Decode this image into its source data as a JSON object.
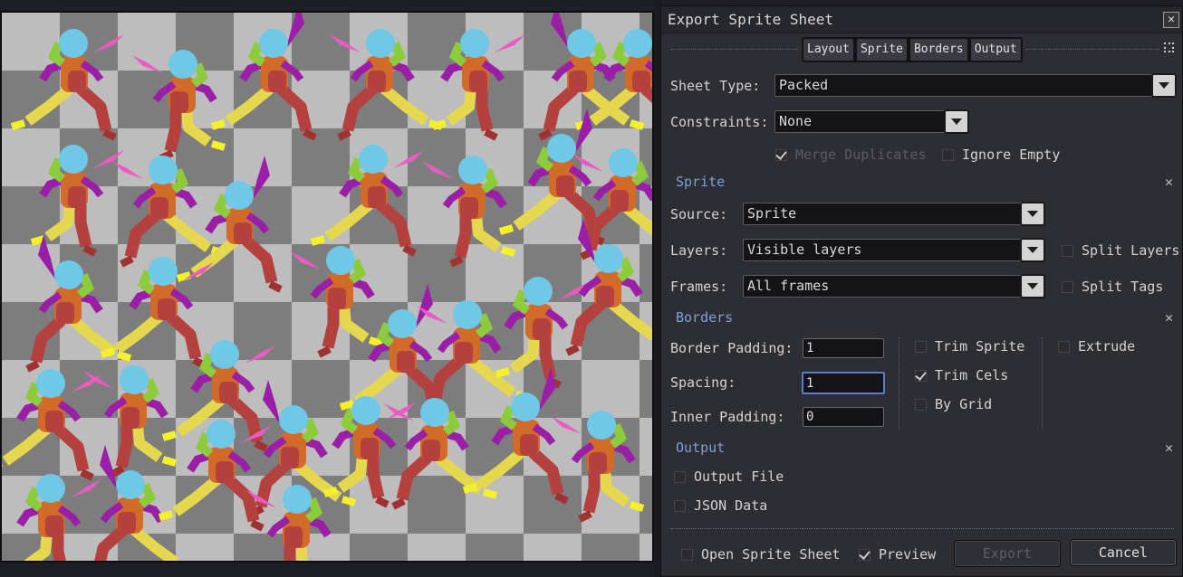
{
  "dialog": {
    "title": "Export Sprite Sheet",
    "close_glyph": "✕",
    "tabs": [
      "Layout",
      "Sprite",
      "Borders",
      "Output"
    ]
  },
  "layout": {
    "sheet_type_label": "Sheet Type:",
    "sheet_type_value": "Packed",
    "constraints_label": "Constraints:",
    "constraints_value": "None",
    "merge_duplicates": {
      "label": "Merge Duplicates",
      "checked": true,
      "enabled": false
    },
    "ignore_empty": {
      "label": "Ignore Empty",
      "checked": false
    }
  },
  "sprite": {
    "section_title": "Sprite",
    "source_label": "Source:",
    "source_value": "Sprite",
    "layers_label": "Layers:",
    "layers_value": "Visible layers",
    "frames_label": "Frames:",
    "frames_value": "All frames",
    "split_layers": {
      "label": "Split Layers",
      "checked": false
    },
    "split_tags": {
      "label": "Split Tags",
      "checked": false
    }
  },
  "borders": {
    "section_title": "Borders",
    "border_padding_label": "Border Padding:",
    "border_padding_value": "1",
    "spacing_label": "Spacing:",
    "spacing_value": "1",
    "inner_padding_label": "Inner Padding:",
    "inner_padding_value": "0",
    "trim_sprite": {
      "label": "Trim Sprite",
      "checked": false
    },
    "trim_cels": {
      "label": "Trim Cels",
      "checked": true
    },
    "by_grid": {
      "label": "By Grid",
      "checked": false
    },
    "extrude": {
      "label": "Extrude",
      "checked": false
    }
  },
  "output": {
    "section_title": "Output",
    "output_file": {
      "label": "Output File",
      "checked": false
    },
    "json_data": {
      "label": "JSON Data",
      "checked": false
    }
  },
  "footer": {
    "open_sprite_sheet": {
      "label": "Open Sprite Sheet",
      "checked": false
    },
    "preview": {
      "label": "Preview",
      "checked": true
    },
    "export_label": "Export",
    "cancel_label": "Cancel"
  },
  "colors": {
    "checker_light": "#bdbdbd",
    "checker_dark": "#7d7d7d",
    "head": "#6ec8e6",
    "body": "#d26a2a",
    "shade": "#b4413e",
    "arm": "#8ccc3c",
    "leg": "#e6d84e",
    "foot": "#f4f02a",
    "boot": "#a03232",
    "purple": "#9b1ea6",
    "pink": "#ea5cc4",
    "section_title": "#7f9ed6",
    "focus": "#5b7ec9"
  }
}
